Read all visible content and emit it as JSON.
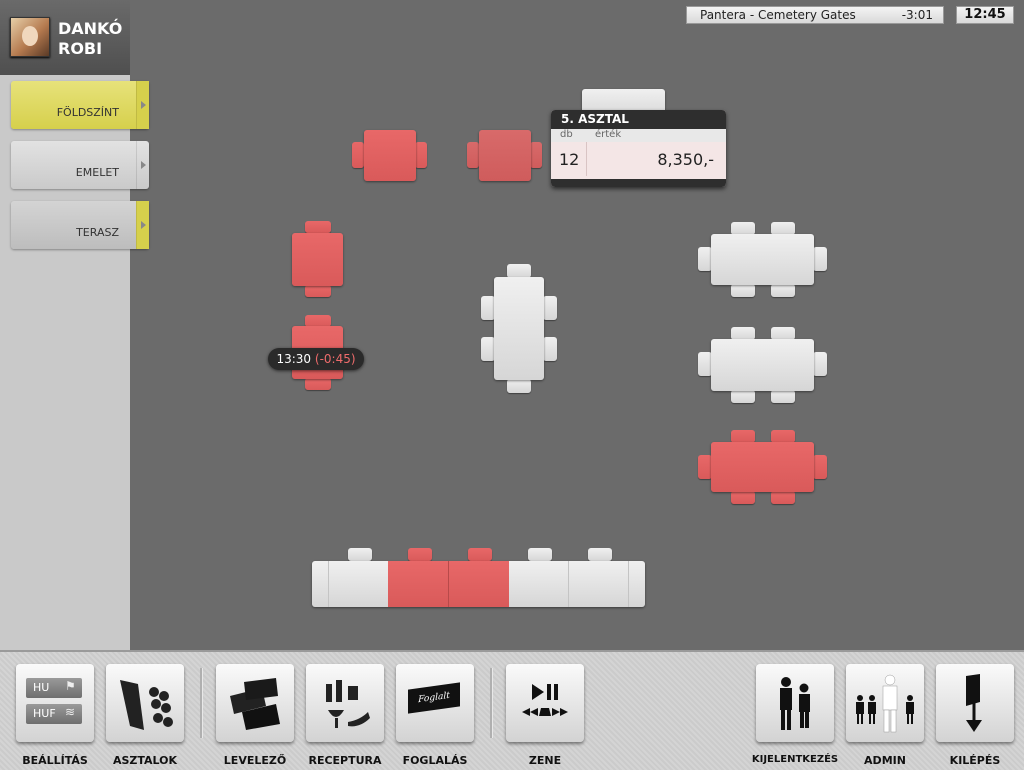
{
  "user": {
    "name": "DANKÓ ROBI"
  },
  "floors": [
    {
      "label": "FÖLDSZÍNT",
      "selected": true
    },
    {
      "label": "EMELET",
      "selected": false
    },
    {
      "label": "TERASZ",
      "selected": false
    }
  ],
  "now_playing": {
    "title": "Pantera - Cemetery Gates",
    "remaining": "-3:01"
  },
  "clock": "12:45",
  "table_popup": {
    "title": "5. ASZTAL",
    "col_qty": "db",
    "col_value": "érték",
    "qty": "12",
    "value": "8,350,-"
  },
  "timer_badge": {
    "time": "13:30",
    "delta": "(-0:45)"
  },
  "language": {
    "lang": "HU",
    "currency": "HUF"
  },
  "toolbar": [
    {
      "id": "settings",
      "label": "BEÁLLÍTÁS",
      "icon": "settings-icon"
    },
    {
      "id": "tables",
      "label": "ASZTALOK",
      "icon": "tables-icon"
    },
    {
      "id": "mail",
      "label": "LEVELEZŐ",
      "icon": "mail-icon"
    },
    {
      "id": "reception",
      "label": "RECEPTURA",
      "icon": "recipe-icon"
    },
    {
      "id": "booking",
      "label": "FOGLALÁS",
      "icon": "booking-icon"
    },
    {
      "id": "music",
      "label": "ZENE",
      "icon": "music-icon"
    },
    {
      "id": "logout",
      "label": "KIJELENTKEZÉS",
      "icon": "people-icon"
    },
    {
      "id": "admin",
      "label": "ADMIN",
      "icon": "admin-icon"
    },
    {
      "id": "exit",
      "label": "KILÉPÉS",
      "icon": "exit-icon"
    }
  ],
  "booking_icon_text": "Foglalt",
  "colors": {
    "occupied": "#d95a5a",
    "free": "#e0e0e0",
    "selected_floor": "#d6d04c"
  }
}
